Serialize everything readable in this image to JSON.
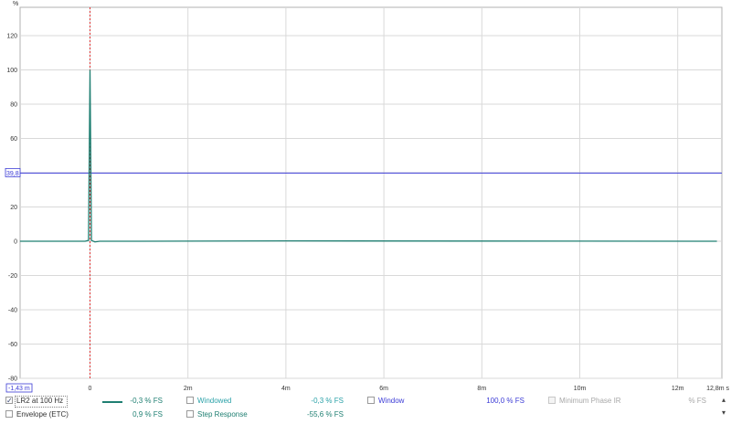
{
  "plot": {
    "y_unit": "%",
    "y_ticks": [
      "120",
      "100",
      "80",
      "60",
      "40",
      "20",
      "0",
      "-20",
      "-40",
      "-60",
      "-80"
    ],
    "x_ticks": [
      "0",
      "2m",
      "4m",
      "6m",
      "8m",
      "10m",
      "12m"
    ],
    "x_end_label": "12,8m s",
    "x_start_readout": "-1,43 m",
    "window_level_readout": "39,8",
    "colors": {
      "grid": "#d9d9d9",
      "axis_text": "#333333",
      "cursor": "#e03030",
      "window_line": "#3b3bd6",
      "trace": "#1f7f72"
    }
  },
  "chart_data": {
    "type": "line",
    "xlabel": "s",
    "ylabel": "%",
    "xlim": [
      -0.00143,
      0.0128
    ],
    "ylim": [
      -85,
      130
    ],
    "series": [
      {
        "name": "LR2 at 100 Hz",
        "x": [
          -0.00143,
          -0.0001,
          -3e-05,
          0.0,
          3e-05,
          0.0001,
          0.0002,
          0.001,
          0.004,
          0.008,
          0.0128
        ],
        "y": [
          0,
          0,
          0.5,
          100,
          0.5,
          -0.4,
          0,
          0,
          0.2,
          0.1,
          0
        ]
      }
    ],
    "horizontal_lines": [
      {
        "name": "Window",
        "y": 39.8
      }
    ],
    "vertical_markers": [
      {
        "x": 0.0
      }
    ]
  },
  "legend": {
    "rows": [
      [
        {
          "label": "LR2 at 100 Hz",
          "value": "-0,3 % FS",
          "checked": true,
          "color": "#1f7f72",
          "swatch": true,
          "enabled": true,
          "selected": true
        },
        {
          "label": "Windowed",
          "value": "-0,3 % FS",
          "checked": false,
          "color": "#2aa1a8",
          "swatch": false,
          "enabled": true
        },
        {
          "label": "Window",
          "value": "100,0 % FS",
          "checked": false,
          "color": "#3b3bd6",
          "swatch": false,
          "enabled": true
        },
        {
          "label": "Minimum Phase IR",
          "value": "% FS",
          "checked": false,
          "color": "#a8a8a8",
          "swatch": false,
          "enabled": false
        }
      ],
      [
        {
          "label": "Envelope (ETC)",
          "value": "0,9 % FS",
          "checked": false,
          "color": "#1f7f72",
          "swatch": false,
          "enabled": true
        },
        {
          "label": "Step Response",
          "value": "-55,6 % FS",
          "checked": false,
          "color": "#1f7f72",
          "swatch": false,
          "enabled": true
        }
      ]
    ],
    "scroll_up_icon": "triangle-up-icon",
    "scroll_down_icon": "triangle-down-icon"
  }
}
